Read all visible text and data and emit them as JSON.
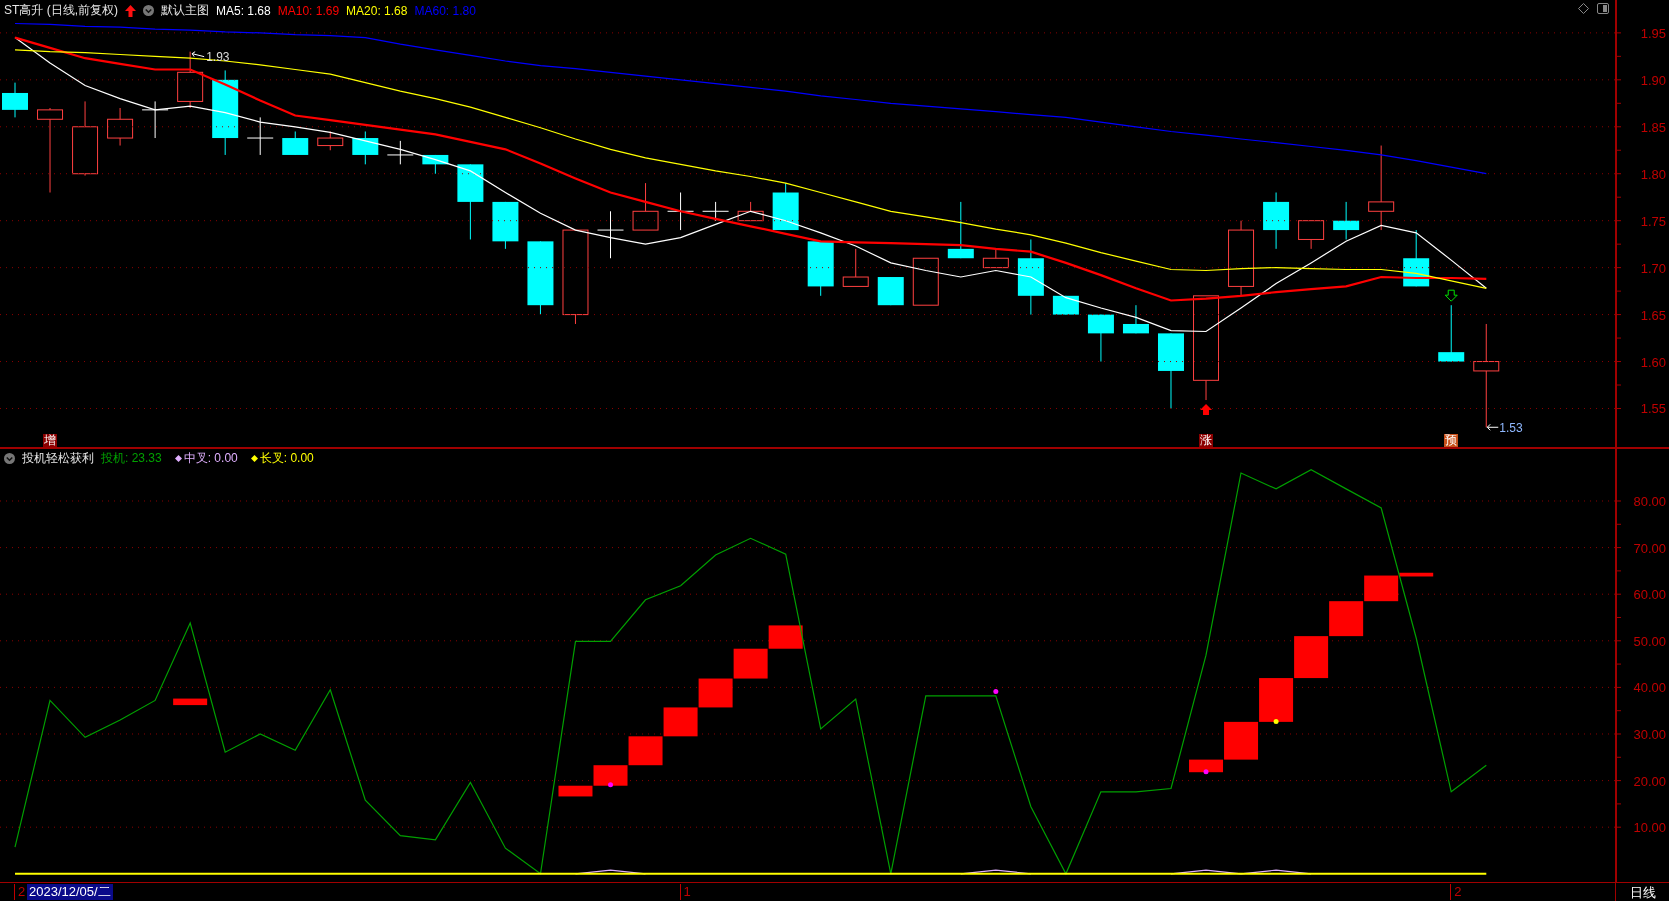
{
  "header": {
    "title": "ST高升 (日线,前复权)",
    "template": "默认主图",
    "legend": [
      {
        "label": "MA5: 1.68"
      },
      {
        "label": "MA10: 1.69"
      },
      {
        "label": "MA20: 1.68"
      },
      {
        "label": "MA60: 1.80"
      }
    ]
  },
  "price_chart": {
    "chart_data": {
      "type": "line",
      "grid": true,
      "ylim": [
        1.509,
        1.985
      ],
      "yticks": [
        {
          "value": 1.55,
          "label": "1.55"
        },
        {
          "value": 1.6,
          "label": "1.60"
        },
        {
          "value": 1.65,
          "label": "1.65"
        },
        {
          "value": 1.7,
          "label": "1.70"
        },
        {
          "value": 1.75,
          "label": "1.75"
        },
        {
          "value": 1.8,
          "label": "1.80"
        },
        {
          "value": 1.85,
          "label": "1.85"
        },
        {
          "value": 1.9,
          "label": "1.90"
        },
        {
          "value": 1.95,
          "label": "1.95"
        }
      ],
      "series": [
        {
          "color": "#ffffff",
          "values": [
            1.945,
            1.918,
            1.894,
            1.88,
            1.868,
            1.872,
            1.865,
            1.855,
            1.85,
            1.844,
            1.835,
            1.826,
            1.815,
            1.803,
            1.78,
            1.758,
            1.74,
            1.732,
            1.725,
            1.732,
            1.746,
            1.76,
            1.75,
            1.737,
            1.723,
            1.705,
            1.697,
            1.69,
            1.697,
            1.69,
            1.668,
            1.657,
            1.647,
            1.633,
            1.632,
            1.657,
            1.683,
            1.705,
            1.728,
            1.745,
            1.737,
            1.708,
            1.678
          ]
        },
        {
          "color": "#ff0000",
          "values": [
            1.945,
            1.934,
            1.923,
            1.917,
            1.911,
            1.911,
            1.895,
            1.878,
            1.862,
            1.857,
            1.852,
            1.847,
            1.842,
            1.834,
            1.826,
            1.811,
            1.795,
            1.78,
            1.77,
            1.76,
            1.752,
            1.744,
            1.736,
            1.728,
            1.727,
            1.726,
            1.725,
            1.724,
            1.72,
            1.717,
            1.705,
            1.692,
            1.678,
            1.665,
            1.667,
            1.67,
            1.674,
            1.677,
            1.68,
            1.69,
            1.689,
            1.689,
            1.688
          ]
        },
        {
          "color": "#ffff00",
          "values": [
            1.932,
            1.93,
            1.929,
            1.927,
            1.925,
            1.923,
            1.92,
            1.916,
            1.911,
            1.906,
            1.897,
            1.888,
            1.88,
            1.871,
            1.86,
            1.849,
            1.837,
            1.826,
            1.817,
            1.81,
            1.803,
            1.797,
            1.79,
            1.78,
            1.77,
            1.76,
            1.754,
            1.748,
            1.741,
            1.735,
            1.726,
            1.716,
            1.707,
            1.698,
            1.697,
            1.699,
            1.7,
            1.699,
            1.698,
            1.698,
            1.694,
            1.686,
            1.678
          ]
        },
        {
          "color": "#0000ff",
          "values": [
            1.96,
            1.959,
            1.957,
            1.956,
            1.954,
            1.953,
            1.951,
            1.95,
            1.948,
            1.947,
            1.945,
            1.938,
            1.932,
            1.926,
            1.92,
            1.915,
            1.912,
            1.908,
            1.904,
            1.9,
            1.896,
            1.892,
            1.888,
            1.883,
            1.879,
            1.875,
            1.872,
            1.869,
            1.866,
            1.863,
            1.86,
            1.855,
            1.85,
            1.845,
            1.841,
            1.837,
            1.833,
            1.829,
            1.825,
            1.82,
            1.814,
            1.807,
            1.8
          ]
        }
      ],
      "annotations": [
        {
          "text": "1.93"
        },
        {
          "text": "1.53"
        }
      ]
    },
    "signals": [
      {
        "text": "增",
        "color": "#8b0000"
      },
      {
        "text": "涨",
        "color": "#8b0000"
      },
      {
        "text": "预",
        "color": "#c8501a"
      }
    ]
  },
  "indicator": {
    "title": "投机轻松获利",
    "legend": [
      {
        "label": "投机: 23.33",
        "kind": "plain"
      },
      {
        "label": "中叉: 0.00",
        "kind": "diamond"
      },
      {
        "label": "长叉: 0.00",
        "kind": "diamond"
      }
    ],
    "chart_data": {
      "type": "line",
      "grid": true,
      "ylim": [
        -1.76,
        91.37
      ],
      "yticks": [
        {
          "value": 10,
          "label": "10.00"
        },
        {
          "value": 20,
          "label": "20.00"
        },
        {
          "value": 30,
          "label": "30.00"
        },
        {
          "value": 40,
          "label": "40.00"
        },
        {
          "value": 50,
          "label": "50.00"
        },
        {
          "value": 60,
          "label": "60.00"
        },
        {
          "value": 70,
          "label": "70.00"
        },
        {
          "value": 80,
          "label": "80.00"
        }
      ],
      "series": [
        {
          "color": "#00a000",
          "values": [
            5.7,
            37.2,
            29.3,
            33,
            37.2,
            53.8,
            26.1,
            30,
            26.5,
            39.5,
            15.8,
            8.2,
            7.3,
            19.6,
            5.5,
            0,
            49.9,
            49.9,
            58.8,
            61.8,
            68.4,
            72,
            68.6,
            31.1,
            37.5,
            0,
            38.2,
            38.2,
            38.2,
            14.4,
            0,
            17.6,
            17.6,
            18.3,
            46.9,
            86,
            82.6,
            86.7,
            82.6,
            78.5,
            50.6,
            17.6,
            23.3
          ]
        },
        {
          "color": "#e0b0ff",
          "values": [
            null,
            null,
            null,
            null,
            null,
            null,
            null,
            null,
            null,
            null,
            null,
            null,
            null,
            null,
            null,
            null,
            0,
            0.8,
            0,
            null,
            null,
            null,
            null,
            null,
            null,
            null,
            null,
            0,
            0.8,
            0,
            null,
            null,
            null,
            0,
            0.8,
            0,
            0.8,
            0,
            null,
            null,
            null,
            null,
            null
          ]
        },
        {
          "color": "#ffff00",
          "values": [
            0,
            0,
            0,
            0,
            0,
            0,
            0,
            0,
            0,
            0,
            0,
            0,
            0,
            0,
            0,
            0,
            0,
            0,
            0,
            0,
            0,
            0,
            0,
            0,
            0,
            0,
            0,
            0,
            0,
            0,
            0,
            0,
            0,
            0,
            0,
            0,
            0,
            0,
            0,
            0,
            0,
            0,
            0
          ]
        }
      ]
    }
  },
  "x_axis": {
    "cursor_date": "2023/12/05/二",
    "labels": [
      {
        "text": "2"
      },
      {
        "text": "1"
      },
      {
        "text": "2"
      }
    ],
    "period": "日线"
  }
}
